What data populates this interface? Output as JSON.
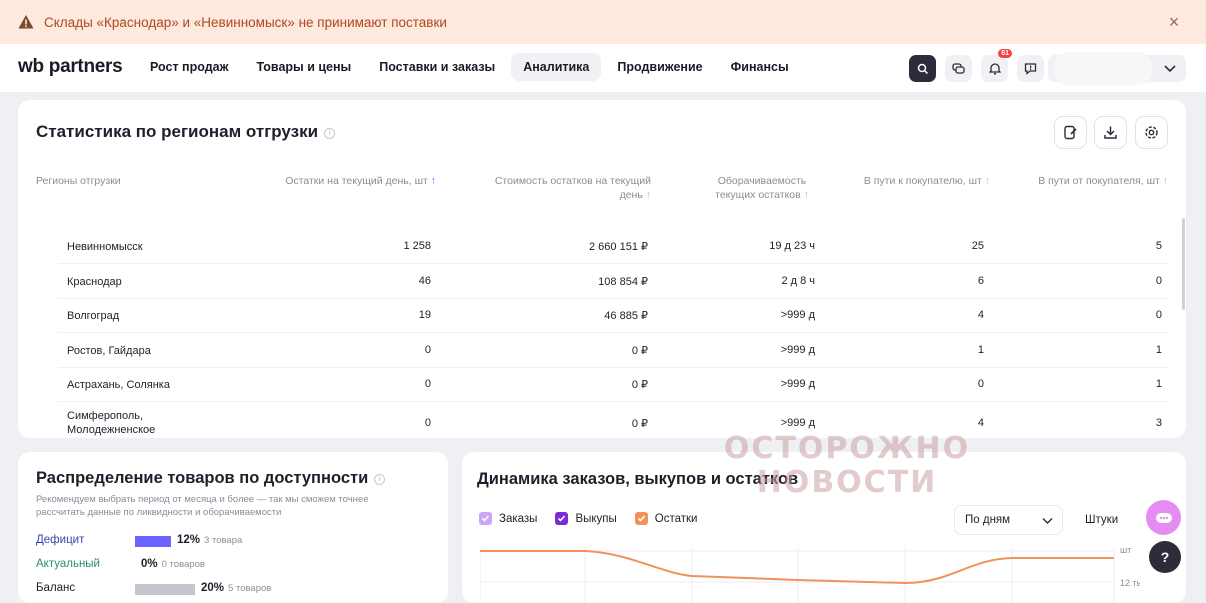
{
  "banner": {
    "text": "Склады «Краснодар» и «Невинномыск» не принимают поставки",
    "close_icon": "×"
  },
  "header": {
    "logo": "wb partners",
    "menu": [
      "Рост продаж",
      "Товары и цены",
      "Поставки и заказы",
      "Аналитика",
      "Продвижение",
      "Финансы"
    ],
    "active_menu": "Аналитика",
    "notification_count": "61"
  },
  "stats": {
    "title": "Статистика по регионам отгрузки",
    "columns": [
      "Регионы отгрузки",
      "Остатки на текущий день, шт",
      "Стоимость остатков на текущий день",
      "Оборачиваемость текущих остатков",
      "В пути к покупателю, шт",
      "В пути от покупателя, шт"
    ],
    "rows": [
      [
        "Невинномысск",
        "1 258",
        "2 660 151 ₽",
        "19 д 23 ч",
        "25",
        "5"
      ],
      [
        "Краснодар",
        "46",
        "108 854 ₽",
        "2 д 8 ч",
        "6",
        "0"
      ],
      [
        "Волгоград",
        "19",
        "46 885 ₽",
        ">999 д",
        "4",
        "0"
      ],
      [
        "Ростов, Гайдара",
        "0",
        "0 ₽",
        ">999 д",
        "1",
        "1"
      ],
      [
        "Астрахань, Солянка",
        "0",
        "0 ₽",
        ">999 д",
        "0",
        "1"
      ],
      [
        "Симферополь, Молодежненское",
        "0",
        "0 ₽",
        ">999 д",
        "4",
        "3"
      ]
    ]
  },
  "distribution": {
    "title": "Распределение товаров по доступности",
    "description": "Рекомендуем выбрать период от месяца и более — так мы сможем точнее рассчитать данные по ликвидности и оборачиваемости",
    "items": [
      {
        "label": "Дефицит",
        "percent": "12%",
        "count": "3 товара",
        "fraction": 0.12,
        "color": "#6b62ff",
        "label_color": "#3a3fae"
      },
      {
        "label": "Актуальный",
        "percent": "0%",
        "count": "0 товаров",
        "fraction": 0,
        "color": "#2fa57a",
        "label_color": "#2a8f6a"
      },
      {
        "label": "Баланс",
        "percent": "20%",
        "count": "5 товаров",
        "fraction": 0.2,
        "color": "#c9c3ce",
        "label_color": "#1f1f2b"
      }
    ]
  },
  "dynamics": {
    "title": "Динамика заказов, выкупов и остатков",
    "legend": [
      {
        "label": "Заказы",
        "color": "#c9a7f5"
      },
      {
        "label": "Выкупы",
        "color": "#7a2bd9"
      },
      {
        "label": "Остатки",
        "color": "#f0935a"
      }
    ],
    "period_select": "По дням",
    "unit_select": "Штуки",
    "y_unit": "шт",
    "y_tick": "12 тыс."
  },
  "watermark": {
    "line1": "ОСТОРОЖНО",
    "line2": "НОВОСТИ"
  },
  "help_label": "?"
}
